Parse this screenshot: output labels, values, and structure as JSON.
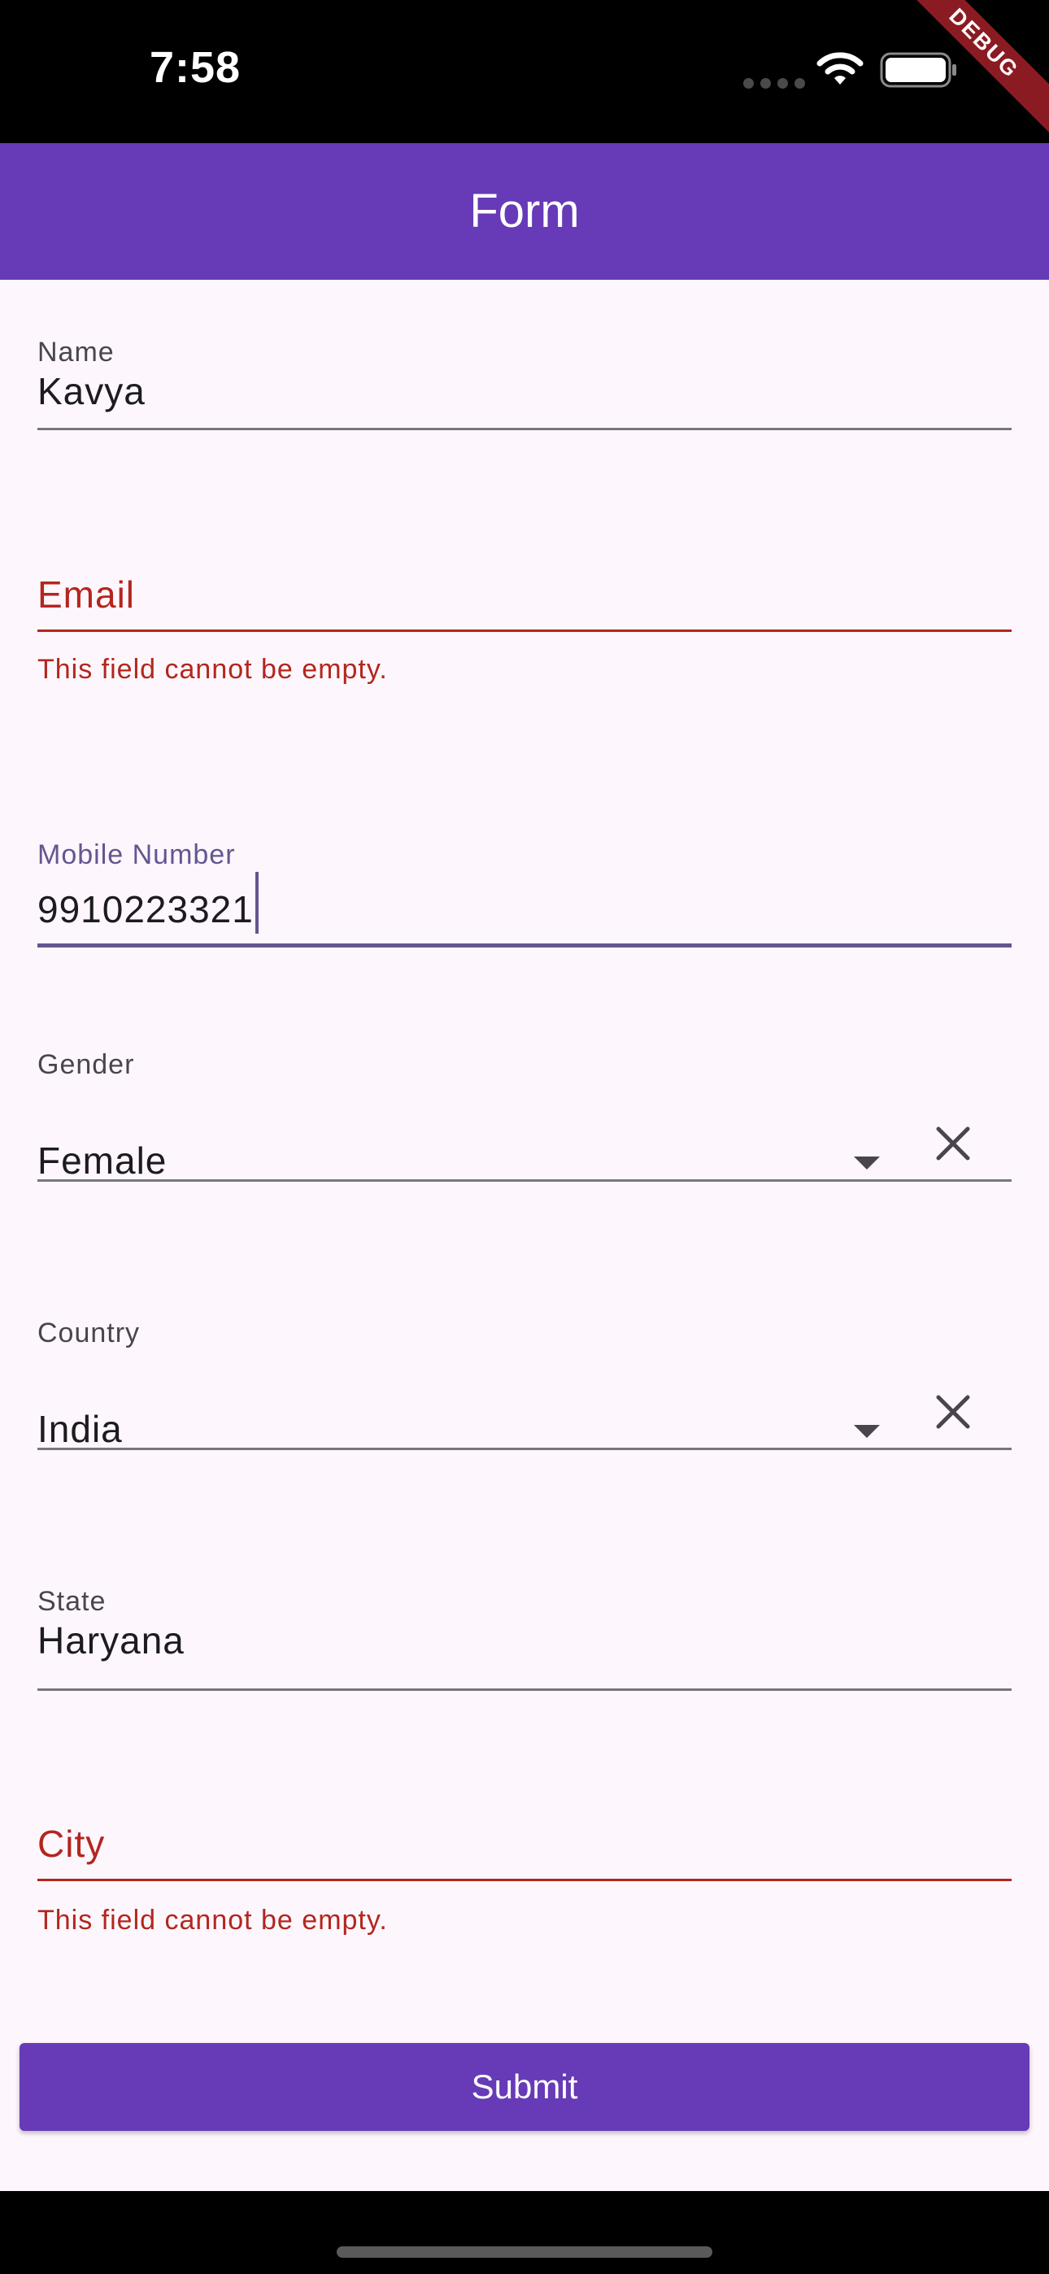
{
  "status_bar": {
    "time": "7:58",
    "icons": [
      "cellular-dots-icon",
      "wifi-icon",
      "battery-icon"
    ],
    "debug_banner": "DEBUG"
  },
  "app_bar": {
    "title": "Form"
  },
  "form": {
    "name": {
      "label": "Name",
      "value": "Kavya"
    },
    "email": {
      "label": "Email",
      "value": "",
      "error": "This field cannot be empty."
    },
    "mobile": {
      "label": "Mobile Number",
      "value": "9910223321"
    },
    "gender": {
      "label": "Gender",
      "value": "Female",
      "icons": [
        "dropdown-arrow-icon",
        "clear-icon"
      ]
    },
    "country": {
      "label": "Country",
      "value": "India",
      "icons": [
        "dropdown-arrow-icon",
        "clear-icon"
      ]
    },
    "state": {
      "label": "State",
      "value": "Haryana"
    },
    "city": {
      "label": "City",
      "value": "",
      "error": "This field cannot be empty."
    },
    "submit_label": "Submit"
  },
  "colors": {
    "primary": "#673ab7",
    "error": "#b3261e",
    "focus": "#65558f",
    "background": "#fdf7fd",
    "debug": "#8b1b22"
  }
}
